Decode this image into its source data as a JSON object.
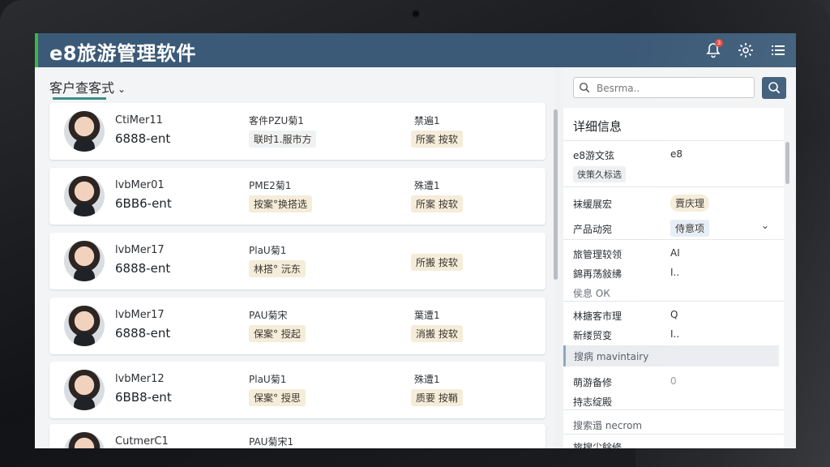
{
  "app": {
    "title": "e8旅游管理软件",
    "notification_count": "3"
  },
  "left": {
    "dropdown_label": "客户查客式",
    "cards": [
      {
        "name": "CtiMer11",
        "code": "6888-ent",
        "mid_label": "客件PZU菊1",
        "tag1": "联时1.服市方",
        "right_label": "禁遍1",
        "tag2": "所案 按软"
      },
      {
        "name": "lvbMer01",
        "code": "6BB6-ent",
        "mid_label": "PME2菊1",
        "tag1": "按案°换搭选",
        "right_label": "殊遭1",
        "tag2": "所案 按软"
      },
      {
        "name": "lvbMer17",
        "code": "6888-ent",
        "mid_label": "PlaU菊1",
        "tag1": "林搭° 沅东",
        "right_label": "",
        "tag2": "所搬 按软"
      },
      {
        "name": "lvbMer17",
        "code": "6888-ent",
        "mid_label": "PAU菊宋",
        "tag1": "保案° 授起",
        "right_label": "葉遭1",
        "tag2": "消搬 按软"
      },
      {
        "name": "lvbMer12",
        "code": "6BB8-ent",
        "mid_label": "PlaU菊1",
        "tag1": "保案° 授思",
        "right_label": "殊遭1",
        "tag2": "质要 按鞘"
      },
      {
        "name": "CutmerC1",
        "code": "",
        "mid_label": "PAU菊宋1",
        "tag1": "",
        "right_label": "",
        "tag2": ""
      }
    ]
  },
  "right": {
    "search_placeholder": "Besrma..",
    "details_title": "详细信息",
    "rows": {
      "r1_label": "e8游文弦",
      "r1_value": "e8",
      "r1_sub": "侠策久标选",
      "r2_label": "袜缓展宏",
      "r2_value": "賣庆理",
      "r3_label": "产品动宛",
      "r3_value": "侍意项",
      "r4_label": "旅管理较领",
      "r4_value": "AI",
      "r5_label": "錦再荡敍绋",
      "r5_value": "I..",
      "r6_label": "侯息 ОК",
      "r7_label": "林搪客市理",
      "r7_value": "Q",
      "r8_label": "新缕贸变",
      "r8_value": "I..",
      "highlight": "搜病 mavintairy",
      "r9_label": "萌游备修",
      "r9_value": "0",
      "r10_label": "持志绽殿",
      "r11_label": "搜索遢 necrom",
      "r12_label": "旅搜尘餘修"
    }
  }
}
